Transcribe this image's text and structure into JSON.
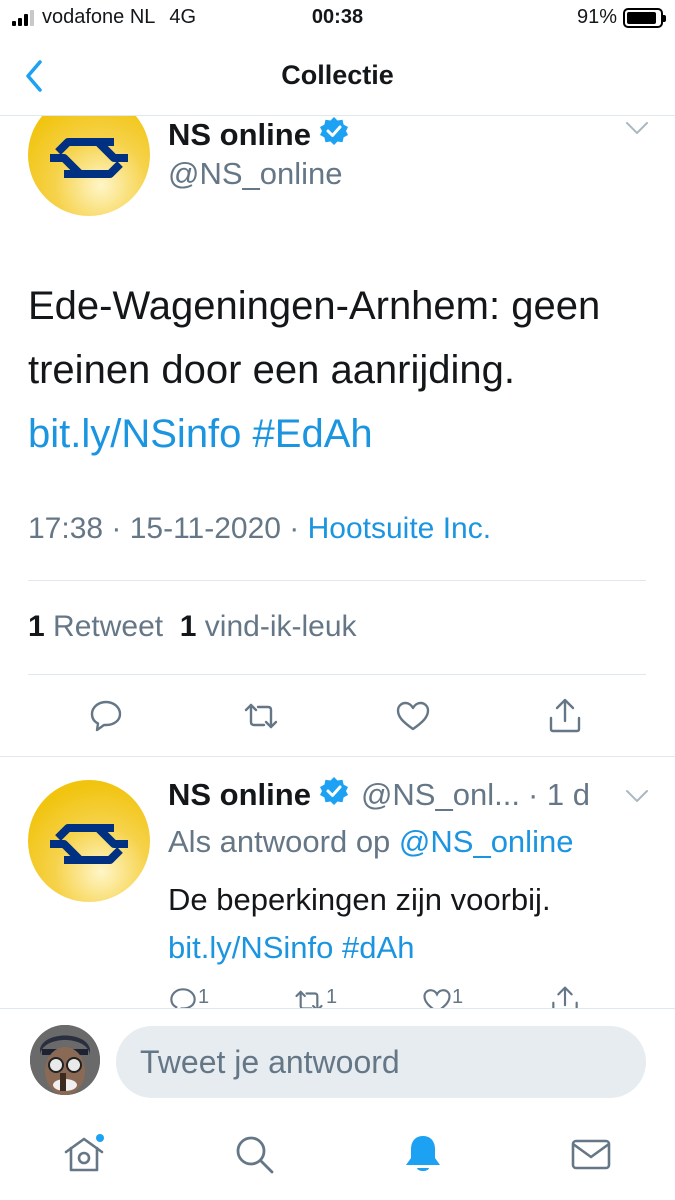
{
  "status_bar": {
    "carrier": "vodafone NL",
    "network": "4G",
    "time": "00:38",
    "battery": "91%",
    "battery_level": 0.91
  },
  "nav": {
    "title": "Collectie"
  },
  "main_tweet": {
    "author": "NS online",
    "handle": "@NS_online",
    "text_part1": "Ede-Wageningen-Arnhem: geen treinen door een aanrijding. ",
    "link": "bit.ly/NSinfo",
    "hashtag": "#EdAh",
    "time": "17:38 · 15-11-2020 · ",
    "source": "Hootsuite Inc.",
    "retweet_count": "1",
    "retweet_label": "Retweet",
    "like_count": "1",
    "like_label": "vind-ik-leuk"
  },
  "reply_tweet": {
    "author": "NS online",
    "handle": "@NS_onl...",
    "age": "· 1 d",
    "reply_prefix": "Als antwoord op ",
    "reply_to": "@NS_online",
    "text": "De beperkingen zijn voorbij.",
    "link": "bit.ly/NSinfo",
    "hashtag": "#dAh",
    "replies": "1",
    "retweets": "1",
    "likes": "1"
  },
  "compose": {
    "placeholder": "Tweet je antwoord"
  },
  "icons": {
    "back": "chevron-left-icon",
    "verified": "verified-badge-icon",
    "caret": "chevron-down-icon",
    "reply": "reply-icon",
    "retweet": "retweet-icon",
    "like": "heart-icon",
    "share": "share-icon",
    "home": "home-icon",
    "search": "search-icon",
    "notifications": "bell-icon",
    "messages": "mail-icon"
  },
  "colors": {
    "accent": "#1da1f2",
    "link": "#1b95e0",
    "muted": "#657786",
    "ns_yellow": "#f1c40f",
    "ns_blue": "#003082"
  }
}
